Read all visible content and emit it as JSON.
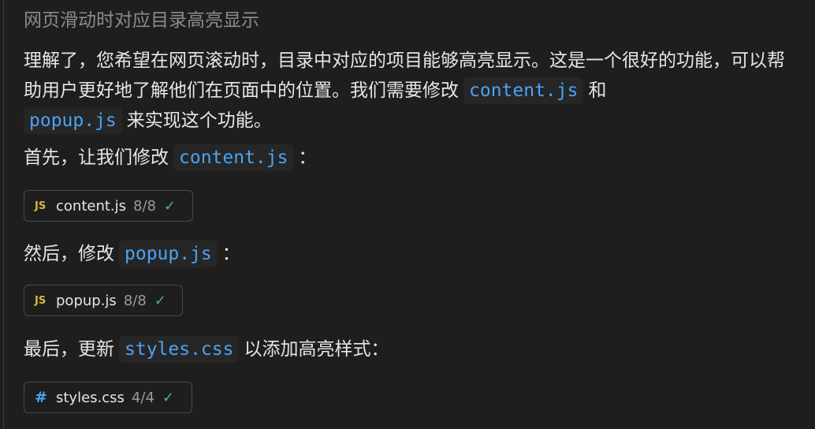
{
  "title": "网页滑动时对应目录高亮显示",
  "intro": {
    "text1": "理解了，您希望在网页滚动时，目录中对应的项目能够高亮显示。这是一个很好的功能，可以帮助用户更好地了解他们在页面中的位置。我们需要修改",
    "code1": "content.js",
    "text2": "和",
    "code2": "popup.js",
    "text3": "来实现这个功能。"
  },
  "step1": {
    "text": "首先，让我们修改",
    "code": "content.js",
    "suffix": "："
  },
  "file1": {
    "icon": "js-icon",
    "icon_text": "JS",
    "name": "content.js",
    "count": "8/8",
    "status": "✓"
  },
  "step2": {
    "text": "然后，修改",
    "code": "popup.js",
    "suffix": "："
  },
  "file2": {
    "icon": "js-icon",
    "icon_text": "JS",
    "name": "popup.js",
    "count": "8/8",
    "status": "✓"
  },
  "step3": {
    "text": "最后，更新",
    "code": "styles.css",
    "suffix": "以添加高亮样式："
  },
  "file3": {
    "icon": "css-hash-icon",
    "icon_text": "#",
    "name": "styles.css",
    "count": "4/4",
    "status": "✓"
  },
  "colors": {
    "background": "#1e1e1e",
    "code": "#4aa3f5",
    "js_icon": "#d7ba3d",
    "check": "#55b36b"
  }
}
